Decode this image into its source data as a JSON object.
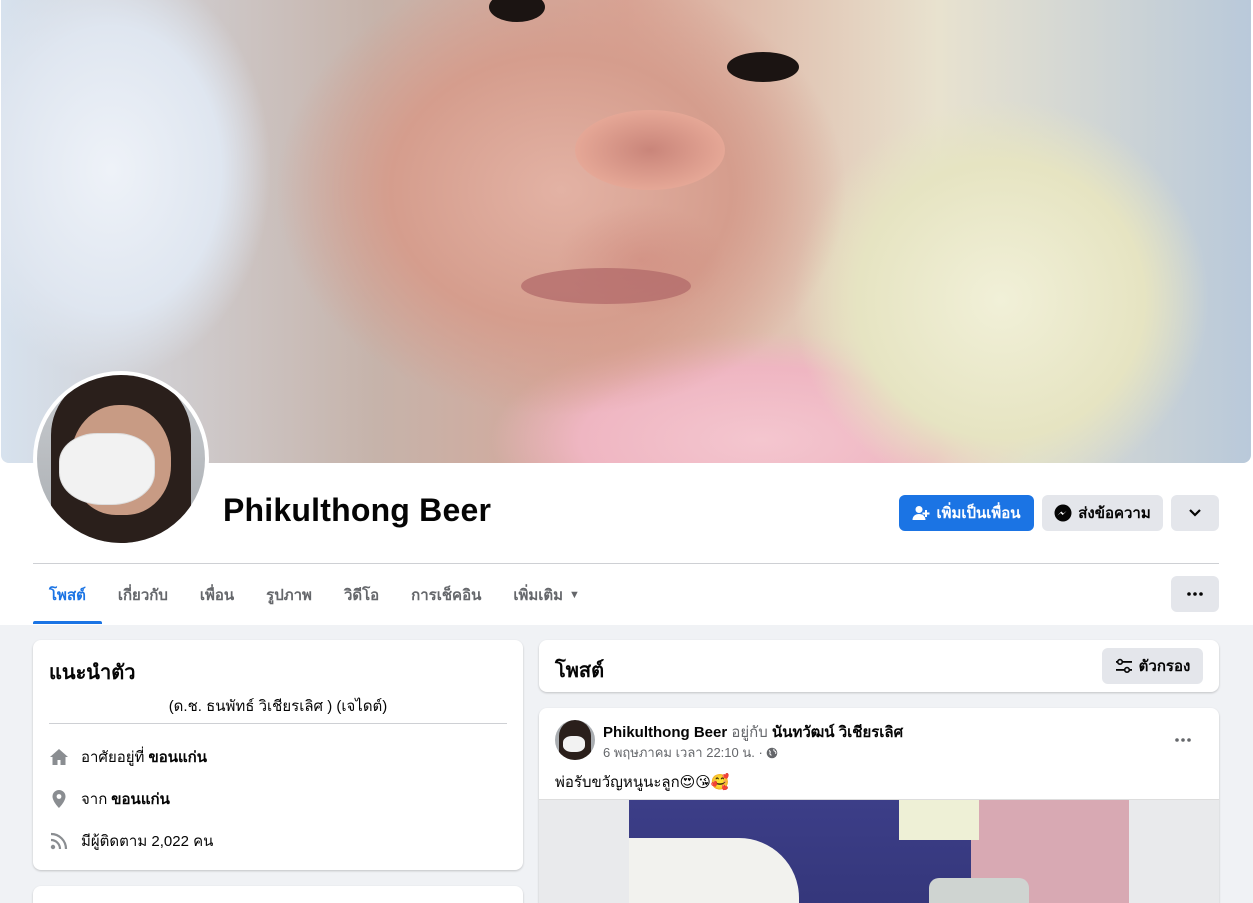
{
  "profile": {
    "name": "Phikulthong Beer"
  },
  "actions": {
    "add_friend_label": "เพิ่มเป็นเพื่อน",
    "message_label": "ส่งข้อความ"
  },
  "tabs": [
    {
      "label": "โพสต์",
      "active": true
    },
    {
      "label": "เกี่ยวกับ"
    },
    {
      "label": "เพื่อน"
    },
    {
      "label": "รูปภาพ"
    },
    {
      "label": "วิดีโอ"
    },
    {
      "label": "การเช็คอิน"
    },
    {
      "label": "เพิ่มเติม"
    }
  ],
  "intro": {
    "title": "แนะนำตัว",
    "bio": "(ด.ช. ธนพัทธ์ วิเชียรเลิศ ) (เจไดต์)",
    "lives_prefix": "อาศัยอยู่ที่",
    "lives_value": "ขอนแก่น",
    "from_prefix": "จาก",
    "from_value": "ขอนแก่น",
    "followers_text": "มีผู้ติดตาม 2,022 คน"
  },
  "posts": {
    "title": "โพสต์",
    "filter_label": "ตัวกรอง"
  },
  "post": {
    "author": "Phikulthong Beer",
    "with_prefix": "อยู่กับ",
    "with_name": "นันทวัฒน์ วิเชียรเลิศ",
    "timestamp": "6 พฤษภาคม เวลา 22:10 น. ·",
    "text": "พ่อรับขวัญหนูนะลูก😍😘🥰"
  },
  "colors": {
    "accent": "#1b74e4",
    "background": "#f0f2f5",
    "muted_text": "#65676b"
  }
}
